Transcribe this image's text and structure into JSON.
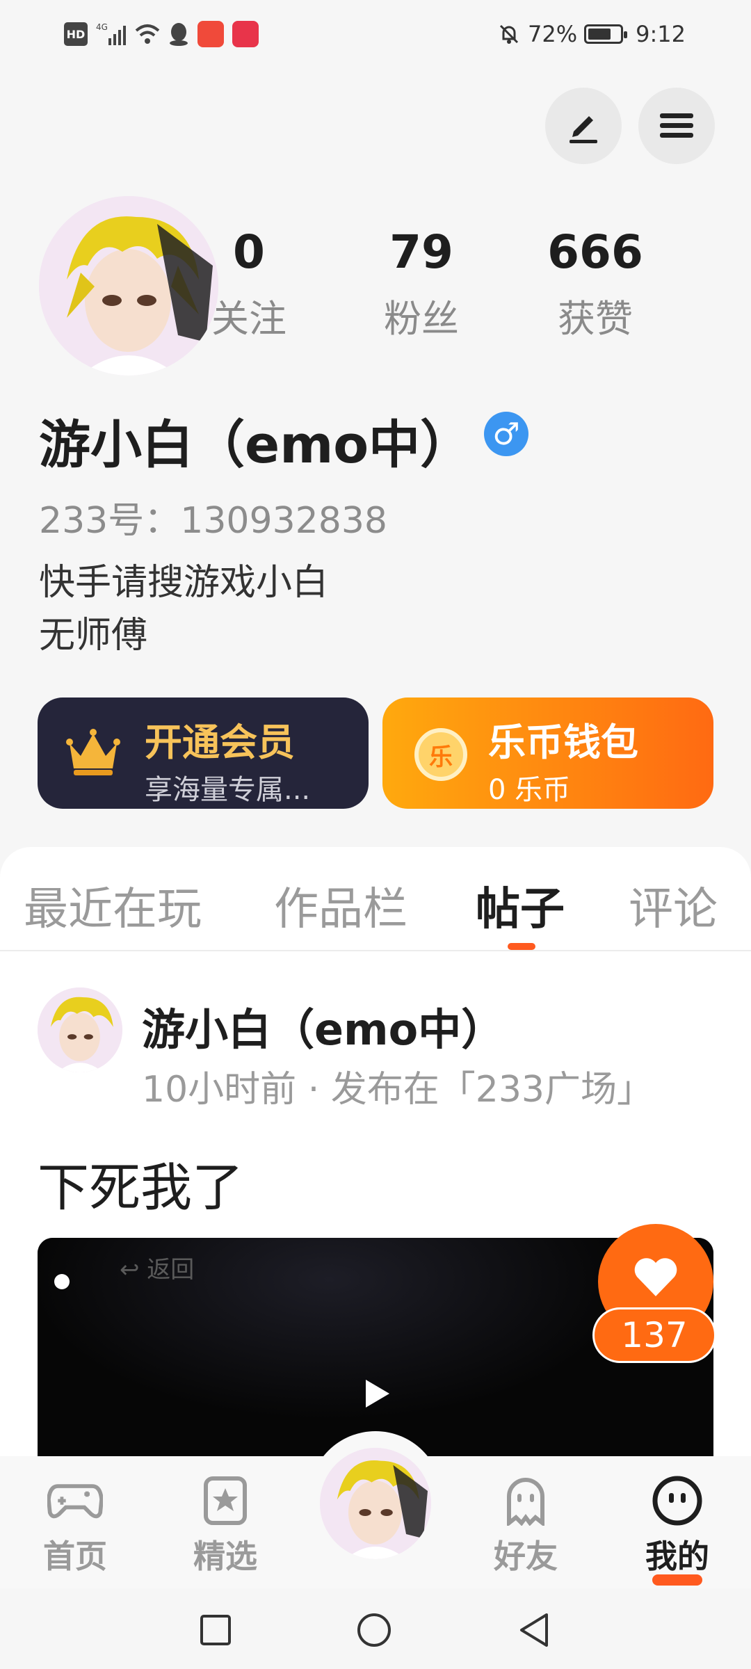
{
  "status_bar": {
    "hd": "HD",
    "network": "4G",
    "battery_text": "72%",
    "battery_level": 0.72,
    "time": "9:12"
  },
  "profile": {
    "stats": [
      {
        "value": "0",
        "label": "关注"
      },
      {
        "value": "79",
        "label": "粉丝"
      },
      {
        "value": "666",
        "label": "获赞"
      }
    ],
    "name": "游小白（emo中）",
    "gender_symbol": "♂",
    "id_label": "233号：130932838",
    "bio_lines": [
      "快手请搜游戏小白",
      "无师傅"
    ]
  },
  "cards": {
    "member_title": "开通会员",
    "member_sub": "享海量专属...",
    "wallet_title": "乐币钱包",
    "wallet_sub": "0 乐币",
    "coin_char": "乐"
  },
  "tabs": [
    {
      "label": "最近在玩",
      "active": false
    },
    {
      "label": "作品栏",
      "active": false
    },
    {
      "label": "帖子",
      "active": true
    },
    {
      "label": "评论",
      "active": false
    }
  ],
  "post": {
    "author": "游小白（emo中）",
    "meta": "10小时前 · 发布在「233广场」",
    "text": "下死我了",
    "video_back_label": "返回",
    "likes": "137"
  },
  "bottom_nav": [
    {
      "label": "首页",
      "icon": "gamepad-icon"
    },
    {
      "label": "精选",
      "icon": "star-card-icon"
    },
    {
      "label": "好友",
      "icon": "ghost-icon"
    },
    {
      "label": "我的",
      "icon": "smile-face-icon"
    }
  ],
  "colors": {
    "accent": "#ff5a1f",
    "member_card": "#25253a",
    "wallet_gradient_start": "#ffa90e",
    "wallet_gradient_end": "#ff6a12",
    "gender_blue": "#3c96f1"
  }
}
